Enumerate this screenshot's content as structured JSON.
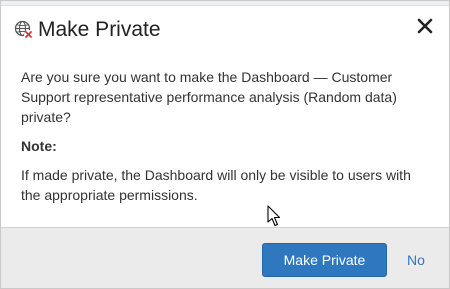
{
  "dialog": {
    "title": "Make Private",
    "title_icon": "globe-private-icon",
    "close_icon": "close-icon"
  },
  "body": {
    "question": "Are you sure you want to make the Dashboard — Customer Support representative performance analysis (Random data) private?",
    "note_label": "Note:",
    "note_text": "If made private, the Dashboard will only be visible to users with the appropriate permissions."
  },
  "footer": {
    "confirm_label": "Make Private",
    "cancel_label": "No"
  },
  "colors": {
    "primary": "#2f78bf",
    "footer_bg": "#ebebeb",
    "icon_accent": "#d9363e"
  }
}
